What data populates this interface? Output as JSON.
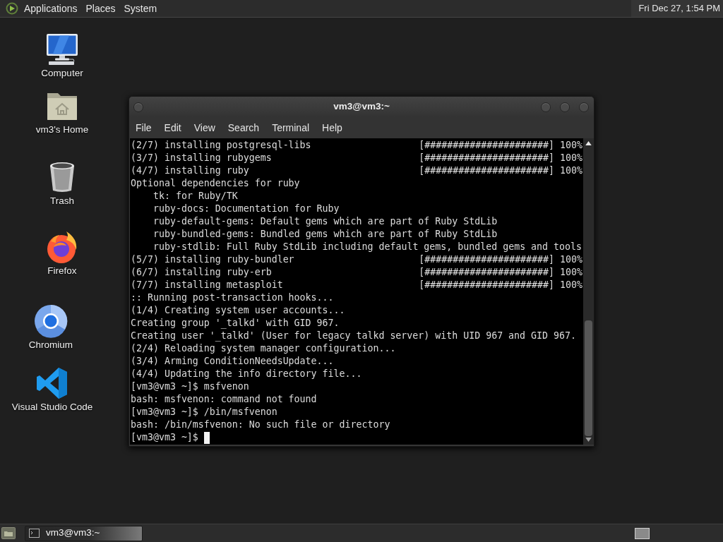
{
  "top_panel": {
    "menus": [
      {
        "label": "Applications"
      },
      {
        "label": "Places"
      },
      {
        "label": "System"
      }
    ],
    "clock": "Fri Dec 27, 1:54 PM"
  },
  "desktop_icons": [
    {
      "kind": "computer",
      "label": "Computer"
    },
    {
      "kind": "home",
      "label": "vm3's Home"
    },
    {
      "kind": "trash",
      "label": "Trash"
    },
    {
      "kind": "firefox",
      "label": "Firefox"
    },
    {
      "kind": "chromium",
      "label": "Chromium"
    },
    {
      "kind": "vscode",
      "label": "Visual Studio Code"
    }
  ],
  "terminal_window": {
    "title": "vm3@vm3:~",
    "menu": [
      "File",
      "Edit",
      "View",
      "Search",
      "Terminal",
      "Help"
    ],
    "lines": [
      {
        "kind": "progress",
        "text": "(2/7) installing postgresql-libs",
        "bar": "[######################]",
        "percent": "100%"
      },
      {
        "kind": "progress",
        "text": "(3/7) installing rubygems",
        "bar": "[######################]",
        "percent": "100%"
      },
      {
        "kind": "progress",
        "text": "(4/7) installing ruby",
        "bar": "[######################]",
        "percent": "100%"
      },
      {
        "kind": "text",
        "text": "Optional dependencies for ruby",
        "children": [
          {
            "kind": "text",
            "text": "tk: for Ruby/TK"
          },
          {
            "kind": "text",
            "text": "ruby-docs: Documentation for Ruby"
          },
          {
            "kind": "text",
            "text": "ruby-default-gems: Default gems which are part of Ruby StdLib"
          },
          {
            "kind": "text",
            "text": "ruby-bundled-gems: Bundled gems which are part of Ruby StdLib"
          },
          {
            "kind": "text",
            "text": "ruby-stdlib: Full Ruby StdLib including default gems, bundled gems and tools"
          }
        ]
      },
      {
        "kind": "progress",
        "text": "(5/7) installing ruby-bundler",
        "bar": "[######################]",
        "percent": "100%"
      },
      {
        "kind": "progress",
        "text": "(6/7) installing ruby-erb",
        "bar": "[######################]",
        "percent": "100%"
      },
      {
        "kind": "progress",
        "text": "(7/7) installing metasploit",
        "bar": "[######################]",
        "percent": "100%"
      },
      {
        "kind": "text",
        "text": ":: Running post-transaction hooks..."
      },
      {
        "kind": "text",
        "text": "(1/4) Creating system user accounts..."
      },
      {
        "kind": "text",
        "text": "Creating group '_talkd' with GID 967."
      },
      {
        "kind": "text",
        "text": "Creating user '_talkd' (User for legacy talkd server) with UID 967 and GID 967."
      },
      {
        "kind": "text",
        "text": "(2/4) Reloading system manager configuration..."
      },
      {
        "kind": "text",
        "text": "(3/4) Arming ConditionNeedsUpdate..."
      },
      {
        "kind": "text",
        "text": "(4/4) Updating the info directory file..."
      },
      {
        "kind": "text",
        "text": "[vm3@vm3 ~]$ msfvenon"
      },
      {
        "kind": "text",
        "text": "bash: msfvenon: command not found"
      },
      {
        "kind": "text",
        "text": "[vm3@vm3 ~]$ /bin/msfvenon"
      },
      {
        "kind": "text",
        "text": "bash: /bin/msfvenon: No such file or directory"
      },
      {
        "kind": "prompt",
        "text": "[vm3@vm3 ~]$",
        "cursor": true
      }
    ]
  },
  "taskbar": {
    "tasks": [
      {
        "label": "vm3@vm3:~",
        "selected": true
      }
    ]
  }
}
